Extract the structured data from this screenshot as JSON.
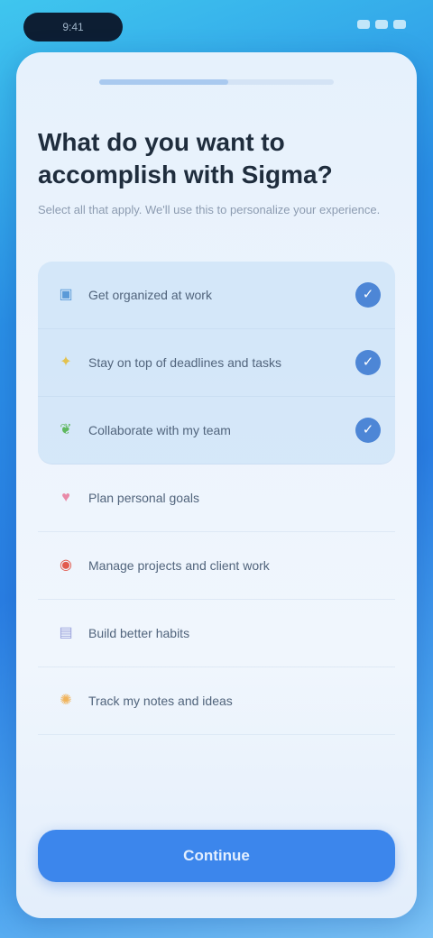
{
  "status_bar": {
    "time": "9:41",
    "icons": [
      "signal-icon",
      "wifi-icon",
      "battery-icon"
    ]
  },
  "progress": {
    "value": 0.55
  },
  "question": {
    "title": "What do you want to accomplish with Sigma?",
    "subtitle": "Select all that apply. We'll use this to personalize your experience."
  },
  "options": [
    {
      "label": "Get organized at work",
      "icon": "briefcase-icon",
      "glyph": "▣",
      "color": "#5b9ad8",
      "selected": true
    },
    {
      "label": "Stay on top of deadlines and tasks",
      "icon": "sparkle-icon",
      "glyph": "✦",
      "color": "#e3c24f",
      "selected": true
    },
    {
      "label": "Collaborate with my team",
      "icon": "leaf-icon",
      "glyph": "❦",
      "color": "#5fb85f",
      "selected": true
    },
    {
      "label": "Plan personal goals",
      "icon": "heart-icon",
      "glyph": "♥",
      "color": "#e98aa8",
      "selected": false
    },
    {
      "label": "Manage projects and client work",
      "icon": "bullseye-icon",
      "glyph": "◉",
      "color": "#e25a4e",
      "selected": false
    },
    {
      "label": "Build better habits",
      "icon": "calendar-icon",
      "glyph": "▤",
      "color": "#9aa2dc",
      "selected": false
    },
    {
      "label": "Track my notes and ideas",
      "icon": "lightbulb-icon",
      "glyph": "✺",
      "color": "#f0b35a",
      "selected": false
    }
  ],
  "checkmark": "✓",
  "cta_label": "Continue"
}
